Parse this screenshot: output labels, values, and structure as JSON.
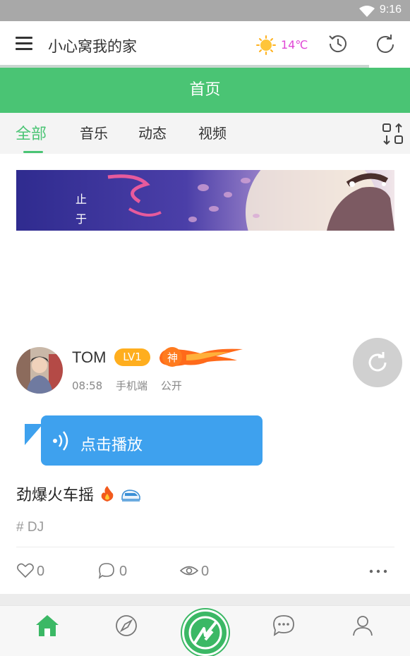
{
  "status_bar": {
    "time": "9:16"
  },
  "top_bar": {
    "title": "小心窝我的家",
    "temperature": "14℃",
    "loading_progress_percent": 90
  },
  "header": {
    "title": "首页"
  },
  "tabs": [
    {
      "label": "全部",
      "active": true
    },
    {
      "label": "音乐",
      "active": false
    },
    {
      "label": "动态",
      "active": false
    },
    {
      "label": "视频",
      "active": false
    }
  ],
  "banner": {
    "text_line_1": "止",
    "text_line_2": "于"
  },
  "post": {
    "author": "TOM",
    "level": "LV1",
    "title_badge": "神",
    "time": "08:58",
    "device": "手机端",
    "visibility": "公开",
    "voice_label": "点击播放",
    "content": "劲爆火车摇",
    "tag": "# DJ",
    "likes": "0",
    "comments": "0",
    "views": "0"
  },
  "colors": {
    "accent": "#4ac474",
    "voice_bubble": "#3ea1ee",
    "level_badge": "#ffae1e",
    "temperature": "#e046d6"
  },
  "icons": {
    "menu": "hamburger-icon",
    "weather": "sun-icon",
    "history": "history-icon",
    "refresh": "refresh-icon",
    "sort": "sort-icon",
    "like": "heart-icon",
    "comment": "comment-icon",
    "view": "eye-icon",
    "more": "more-icon",
    "nav": [
      "home-icon",
      "compass-icon",
      "center-logo-icon",
      "chat-icon",
      "user-icon"
    ]
  }
}
